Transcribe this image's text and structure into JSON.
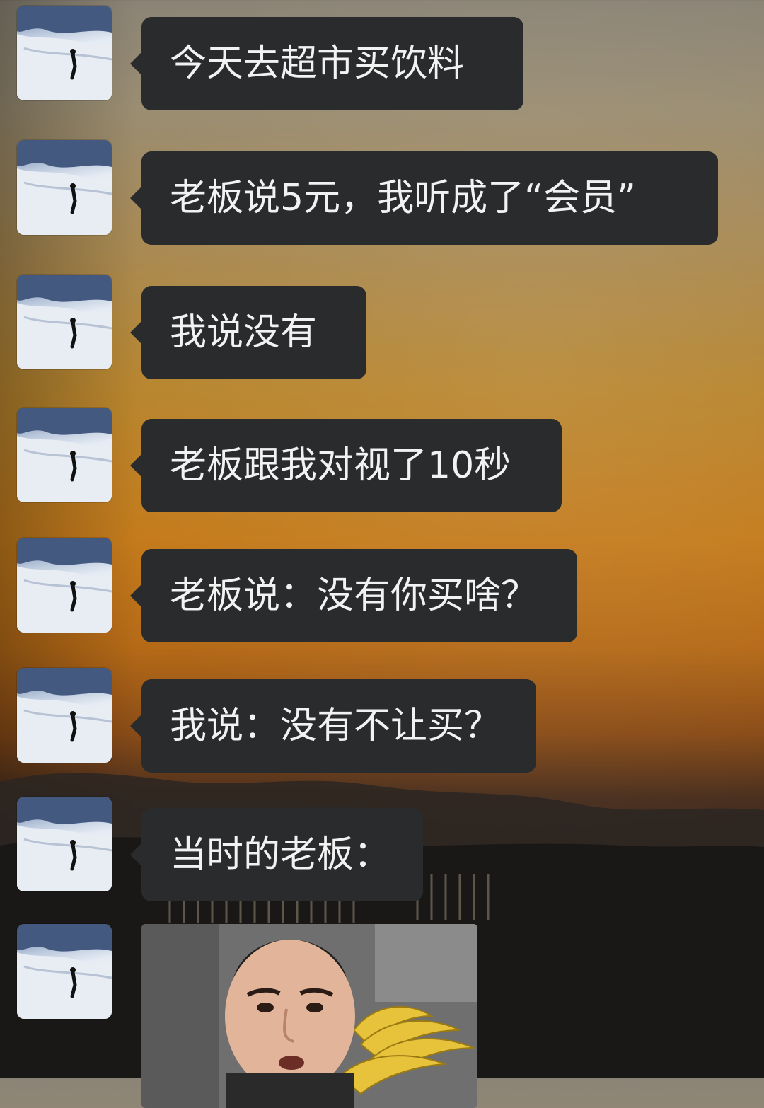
{
  "messages": [
    {
      "text": "今天去超市买饮料"
    },
    {
      "text": "老板说5元，我听成了“会员”"
    },
    {
      "text": "我说没有"
    },
    {
      "text": "老板跟我对视了10秒"
    },
    {
      "text": "老板说：没有你买啥？"
    },
    {
      "text": "我说：没有不让买？"
    },
    {
      "text": "当时的老板："
    }
  ],
  "colors": {
    "bubble_bg": "#2a2b2d",
    "bubble_text": "#f2f2f2"
  },
  "icons": {
    "avatar": "snowy-mountain-skier-avatar",
    "image_message": "man-with-bananas-photo"
  }
}
